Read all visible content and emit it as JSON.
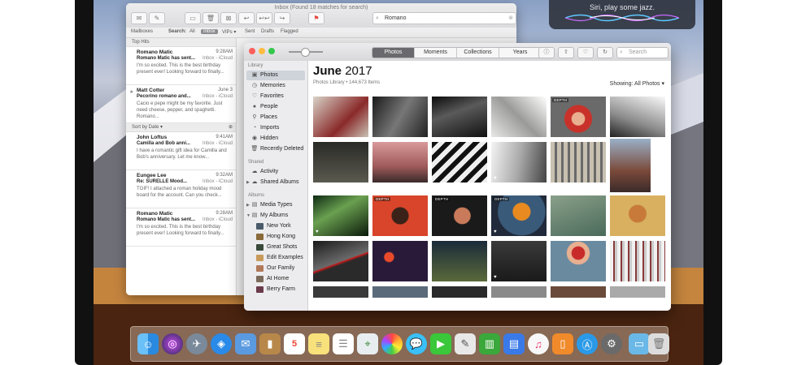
{
  "siri": {
    "text": "Siri, play some jazz."
  },
  "mail": {
    "title": "Inbox (Found 18 matches for search)",
    "search_value": "Romano",
    "favorites": {
      "mailboxes": "Mailboxes",
      "search_label": "Search:",
      "all": "All",
      "inbox": "Inbox",
      "vips": "VIPs ▾",
      "sent": "Sent",
      "drafts": "Drafts",
      "flagged": "Flagged"
    },
    "sections": {
      "top_hits": "Top Hits",
      "sort": "Sort by Date ▾"
    },
    "messages": [
      {
        "from": "Romano Matic",
        "time": "9:28AM",
        "subject": "Romano Matic has sent...",
        "box": "Inbox - iCloud",
        "preview": "I'm so excited. This is the best birthday present ever! Looking forward to finally..."
      },
      {
        "from": "Matt Cotter",
        "time": "June 3",
        "subject": "Pecorino romano and...",
        "box": "Inbox - iCloud",
        "preview": "Cacio e pepe might be my favorite. Just need cheese, pepper, and spaghetti. Romano..."
      },
      {
        "from": "John Loftus",
        "time": "9:41AM",
        "subject": "Camilla and Bob anni...",
        "box": "Inbox - iCloud",
        "preview": "I have a romantic gift idea for Camilla and Bob's anniversary. Let me know..."
      },
      {
        "from": "Eungee Lee",
        "time": "9:32AM",
        "subject": "Re: SURELLE Mood...",
        "box": "Inbox - iCloud",
        "preview": "TGIF! I attached a roman holiday mood board for the account. Can you check..."
      },
      {
        "from": "Romano Matic",
        "time": "9:28AM",
        "subject": "Romano Matic has sent...",
        "box": "Inbox - iCloud",
        "preview": "I'm so excited. This is the best birthday present ever! Looking forward to finally..."
      }
    ]
  },
  "photos": {
    "tabs": [
      "Photos",
      "Moments",
      "Collections",
      "Years"
    ],
    "search_placeholder": "Search",
    "heading_month": "June",
    "heading_year": "2017",
    "subtitle": "Photos Library • 144,673 Items",
    "showing": "Showing: All Photos ▾",
    "sidebar": {
      "library_head": "Library",
      "library": [
        "Photos",
        "Memories",
        "Favorites",
        "People",
        "Places",
        "Imports",
        "Hidden",
        "Recently Deleted"
      ],
      "shared_head": "Shared",
      "shared": [
        "Activity",
        "Shared Albums"
      ],
      "albums_head": "Albums",
      "albums": [
        "Media Types",
        "My Albums"
      ],
      "my_albums": [
        "New York",
        "Hong Kong",
        "Great Shots",
        "Edit Examples",
        "Our Family",
        "At Home",
        "Berry Farm"
      ]
    },
    "depth_label": "DEPTH"
  },
  "colors": {
    "accent": "#6a6a6e",
    "close": "#fc605c",
    "minimize": "#fdbc40",
    "zoom": "#34c84a"
  }
}
